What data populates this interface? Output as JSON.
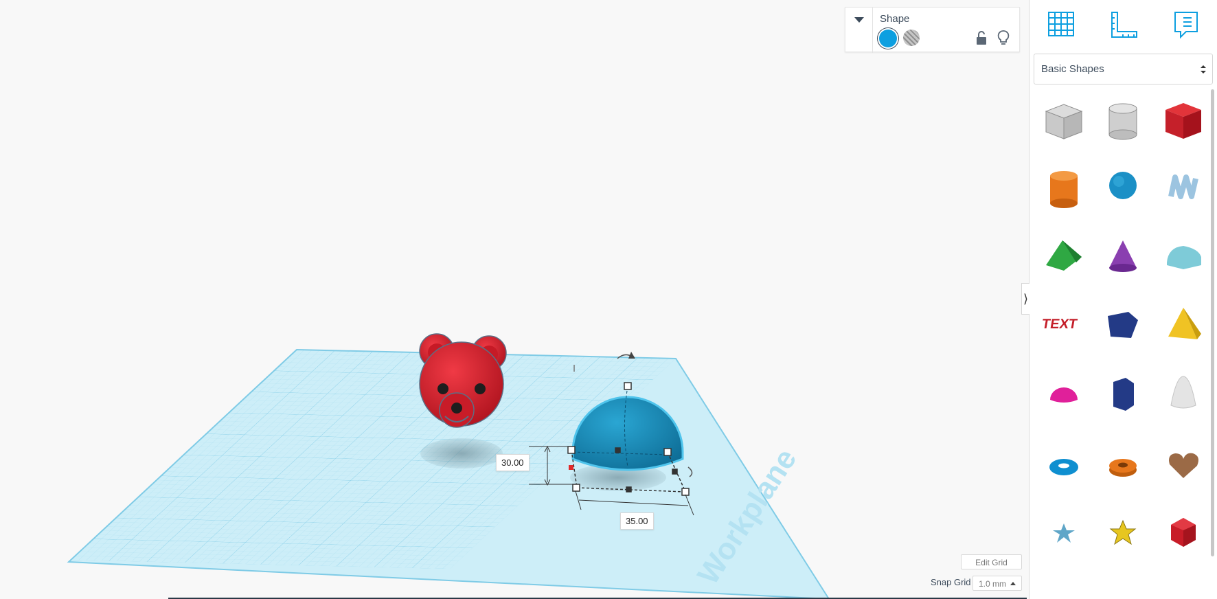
{
  "inspector": {
    "title": "Shape",
    "solid_color": "#0d9fe0",
    "collapse_icon": "chevron-down-icon",
    "lock_icon": "unlock-icon",
    "light_icon": "lightbulb-icon"
  },
  "toolbar": {
    "icons": [
      "workplane-grid-icon",
      "ruler-icon",
      "notes-icon"
    ]
  },
  "library": {
    "selected": "Basic Shapes",
    "shapes": [
      {
        "name": "Box Hole",
        "icon": "box-hole-icon"
      },
      {
        "name": "Cylinder Hole",
        "icon": "cylinder-hole-icon"
      },
      {
        "name": "Box",
        "icon": "box-icon"
      },
      {
        "name": "Cylinder",
        "icon": "cylinder-icon"
      },
      {
        "name": "Sphere",
        "icon": "sphere-icon"
      },
      {
        "name": "Scribble",
        "icon": "scribble-icon"
      },
      {
        "name": "Roof",
        "icon": "roof-icon"
      },
      {
        "name": "Cone",
        "icon": "cone-icon"
      },
      {
        "name": "Round Roof",
        "icon": "round-roof-icon"
      },
      {
        "name": "Text",
        "icon": "text-shape-icon"
      },
      {
        "name": "Polygon",
        "icon": "polygon-icon"
      },
      {
        "name": "Pyramid",
        "icon": "pyramid-icon"
      },
      {
        "name": "Half Sphere",
        "icon": "half-sphere-icon"
      },
      {
        "name": "Hexagonal Prism",
        "icon": "hexagonal-prism-icon"
      },
      {
        "name": "Paraboloid",
        "icon": "paraboloid-icon"
      },
      {
        "name": "Torus",
        "icon": "torus-icon"
      },
      {
        "name": "Tube",
        "icon": "tube-icon"
      },
      {
        "name": "Heart",
        "icon": "heart-icon"
      },
      {
        "name": "Star",
        "icon": "star-icon"
      },
      {
        "name": "Star 3D",
        "icon": "star-3d-icon"
      },
      {
        "name": "Icosahedron",
        "icon": "icosahedron-icon"
      }
    ]
  },
  "workplane": {
    "label": "Workplane",
    "dimensions": {
      "height": "30.00",
      "width": "35.00"
    },
    "edit_grid_label": "Edit Grid",
    "snap_grid_label": "Snap Grid",
    "snap_value": "1.0 mm"
  },
  "colors": {
    "accent": "#0d9fe0",
    "bear_red": "#d61f2c",
    "selected_shape": "#1f89b8",
    "grid": "#9bd9ee"
  }
}
